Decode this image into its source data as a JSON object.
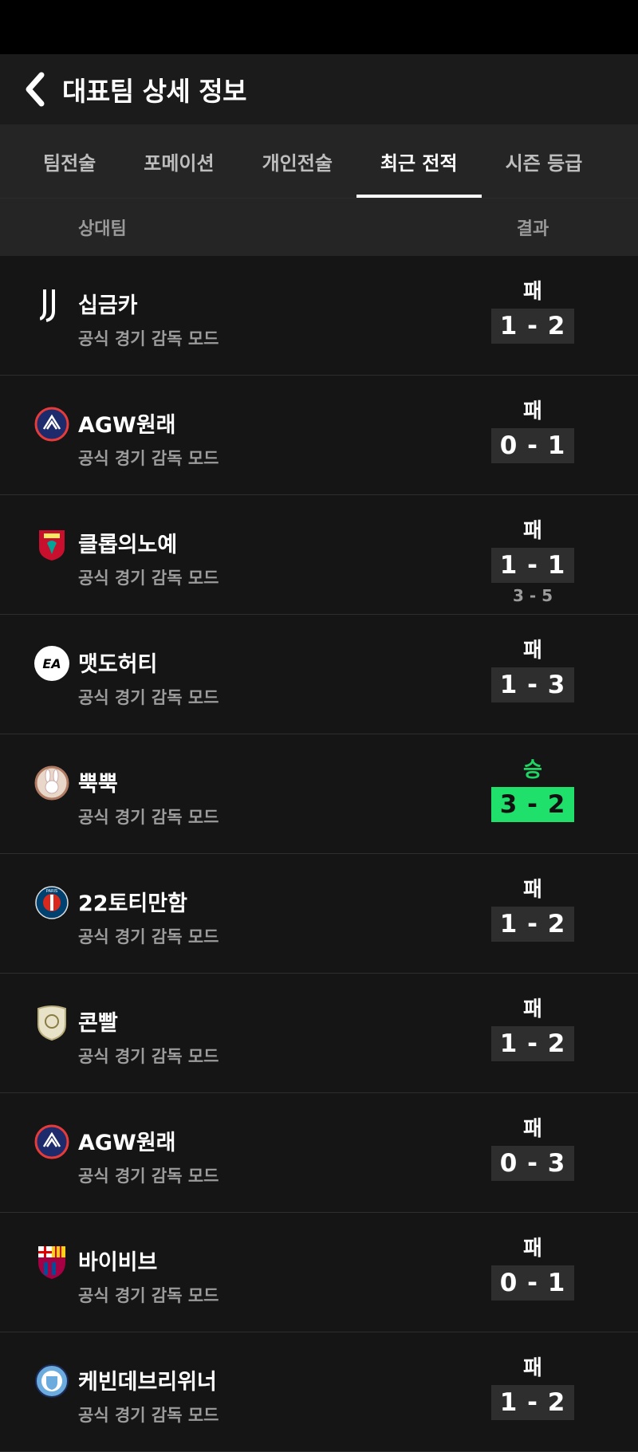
{
  "header": {
    "title": "대표팀 상세 정보"
  },
  "tabs": [
    {
      "label": "팀전술"
    },
    {
      "label": "포메이션"
    },
    {
      "label": "개인전술"
    },
    {
      "label": "최근 전적"
    },
    {
      "label": "시즌 등급"
    }
  ],
  "columns": {
    "opponent": "상대팀",
    "result": "결과"
  },
  "matches": [
    {
      "team": "십금카",
      "mode": "공식 경기 감독 모드",
      "result": "패",
      "score": "1 - 2",
      "logo": "juventus-logo"
    },
    {
      "team": "AGW원래",
      "mode": "공식 경기 감독 모드",
      "result": "패",
      "score": "0 - 1",
      "logo": "andorra-logo"
    },
    {
      "team": "클롭의노예",
      "mode": "공식 경기 감독 모드",
      "result": "패",
      "score": "1 - 1",
      "pk": "3 - 5",
      "logo": "liverpool-logo"
    },
    {
      "team": "맷도허티",
      "mode": "공식 경기 감독 모드",
      "result": "패",
      "score": "1 - 3",
      "logo": "ea-logo"
    },
    {
      "team": "뿍뿍",
      "mode": "공식 경기 감독 모드",
      "result": "승",
      "score": "3 - 2",
      "logo": "rabbit-badge-logo"
    },
    {
      "team": "22토티만함",
      "mode": "공식 경기 감독 모드",
      "result": "패",
      "score": "1 - 2",
      "logo": "psg-logo"
    },
    {
      "team": "콘빨",
      "mode": "공식 경기 감독 모드",
      "result": "패",
      "score": "1 - 2",
      "logo": "icon-shield-logo"
    },
    {
      "team": "AGW원래",
      "mode": "공식 경기 감독 모드",
      "result": "패",
      "score": "0 - 3",
      "logo": "andorra-logo"
    },
    {
      "team": "바이비브",
      "mode": "공식 경기 감독 모드",
      "result": "패",
      "score": "0 - 1",
      "logo": "barcelona-logo"
    },
    {
      "team": "케빈데브리위너",
      "mode": "공식 경기 감독 모드",
      "result": "패",
      "score": "1 - 2",
      "logo": "man-city-logo"
    }
  ],
  "colors": {
    "win": "#1fe06a",
    "loss_box": "#2e2e2e",
    "background": "#151515"
  }
}
